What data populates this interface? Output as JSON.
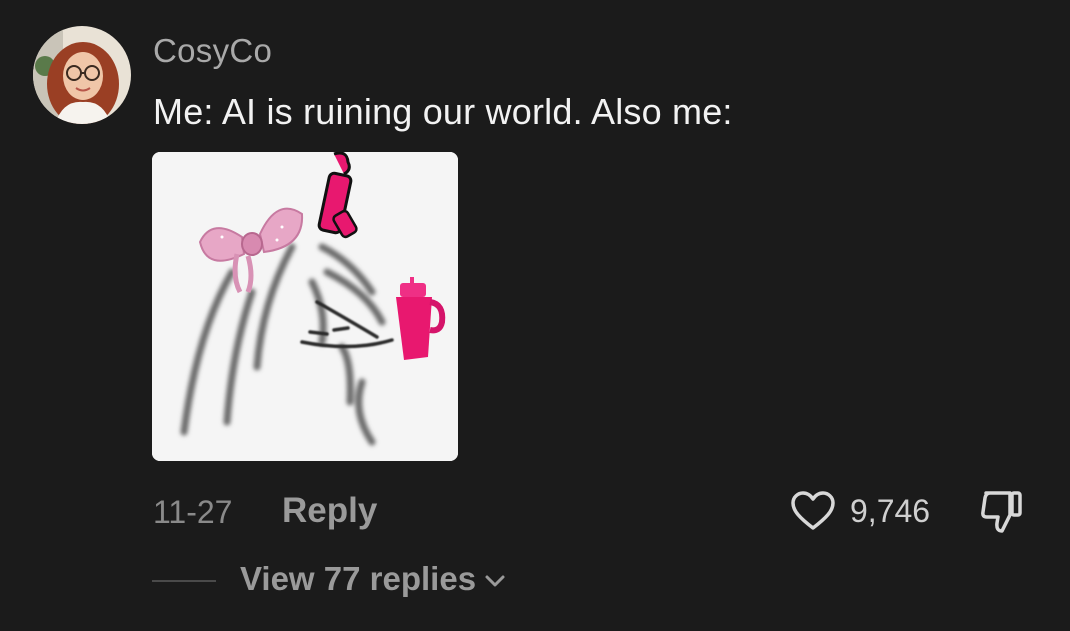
{
  "comment": {
    "username": "CosyCo",
    "text": "Me: AI is ruining our world. Also me:",
    "timestamp": "11-27",
    "reply_label": "Reply",
    "like_count": "9,746",
    "view_replies_label": "View 77 replies"
  },
  "icons": {
    "like": "heart-outline-icon",
    "dislike": "thumbs-down-outline-icon",
    "expand": "chevron-down-icon"
  },
  "colors": {
    "background": "#1b1b1b",
    "username": "#a9a9a9",
    "text": "#f2f2f2",
    "muted": "#9a9a9a",
    "pink_accent": "#e8186f"
  }
}
